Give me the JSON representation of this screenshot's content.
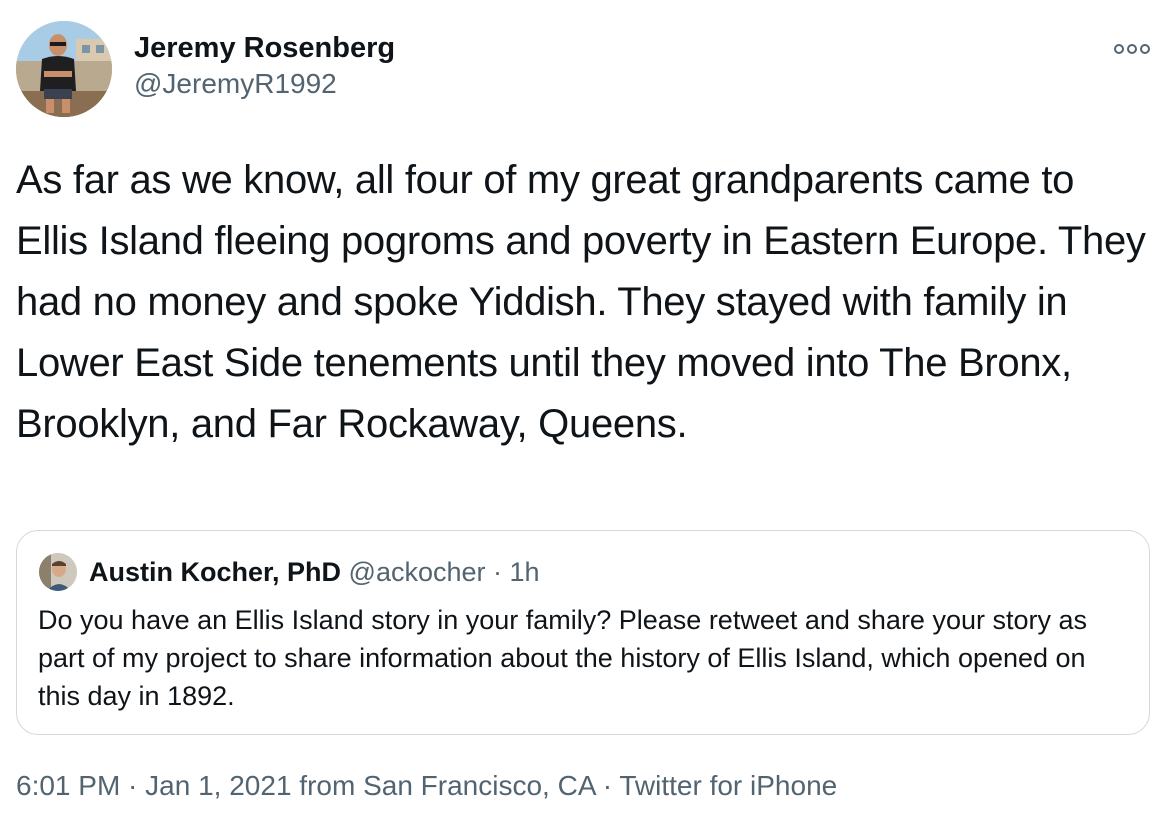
{
  "author": {
    "name": "Jeremy Rosenberg",
    "handle": "@JeremyR1992"
  },
  "menu": {
    "more_icon": "more-options-icon"
  },
  "tweet": {
    "text": "As far as we know, all four of my great grandparents came to Ellis Island fleeing pogroms and poverty in Eastern Europe. They had no money and spoke Yiddish. They stayed with family in Lower East Side tenements until they moved into The Bronx, Brooklyn, and Far Rockaway, Queens."
  },
  "quoted_tweet": {
    "name": "Austin Kocher, PhD",
    "handle": "@ackocher",
    "separator": " · ",
    "time": "1h",
    "text": "Do you have an Ellis Island story in your family? Please retweet and share your story as part of my project to share information about the history of Ellis Island, which opened on this day in 1892."
  },
  "footer": {
    "time": "6:01 PM",
    "separator": " · ",
    "date": "Jan 1, 2021",
    "location_prefix": " from ",
    "location": "San Francisco, CA",
    "source": "Twitter for iPhone"
  },
  "colors": {
    "text_primary": "#0f1419",
    "text_secondary": "#536471",
    "border": "#cfd9de"
  }
}
